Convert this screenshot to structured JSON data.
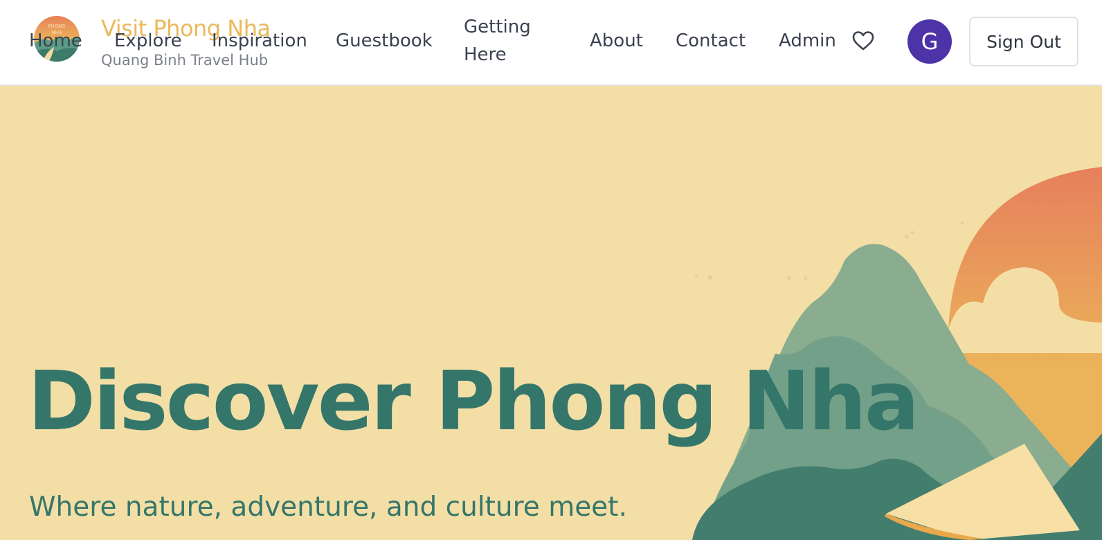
{
  "brand": {
    "logo_text": [
      "PHONG",
      "NHA"
    ],
    "title": "Visit Phong Nha",
    "subtitle": "Quang Binh Travel Hub"
  },
  "nav": {
    "home": "Home",
    "explore": "Explore",
    "inspiration": "Inspiration",
    "guestbook": "Guestbook",
    "getting_here": "Getting Here",
    "about": "About",
    "contact": "Contact",
    "admin": "Admin"
  },
  "user": {
    "avatar_initial": "G",
    "sign_out": "Sign Out"
  },
  "icons": {
    "favorites": "heart-icon"
  },
  "hero": {
    "title": "Discover Phong Nha",
    "subtitle": "Where nature, adventure, and culture meet."
  },
  "colors": {
    "accent_gold": "#ecb85a",
    "hero_bg": "#f3dfa6",
    "hero_text": "#35766a",
    "avatar": "#4c33a8"
  }
}
